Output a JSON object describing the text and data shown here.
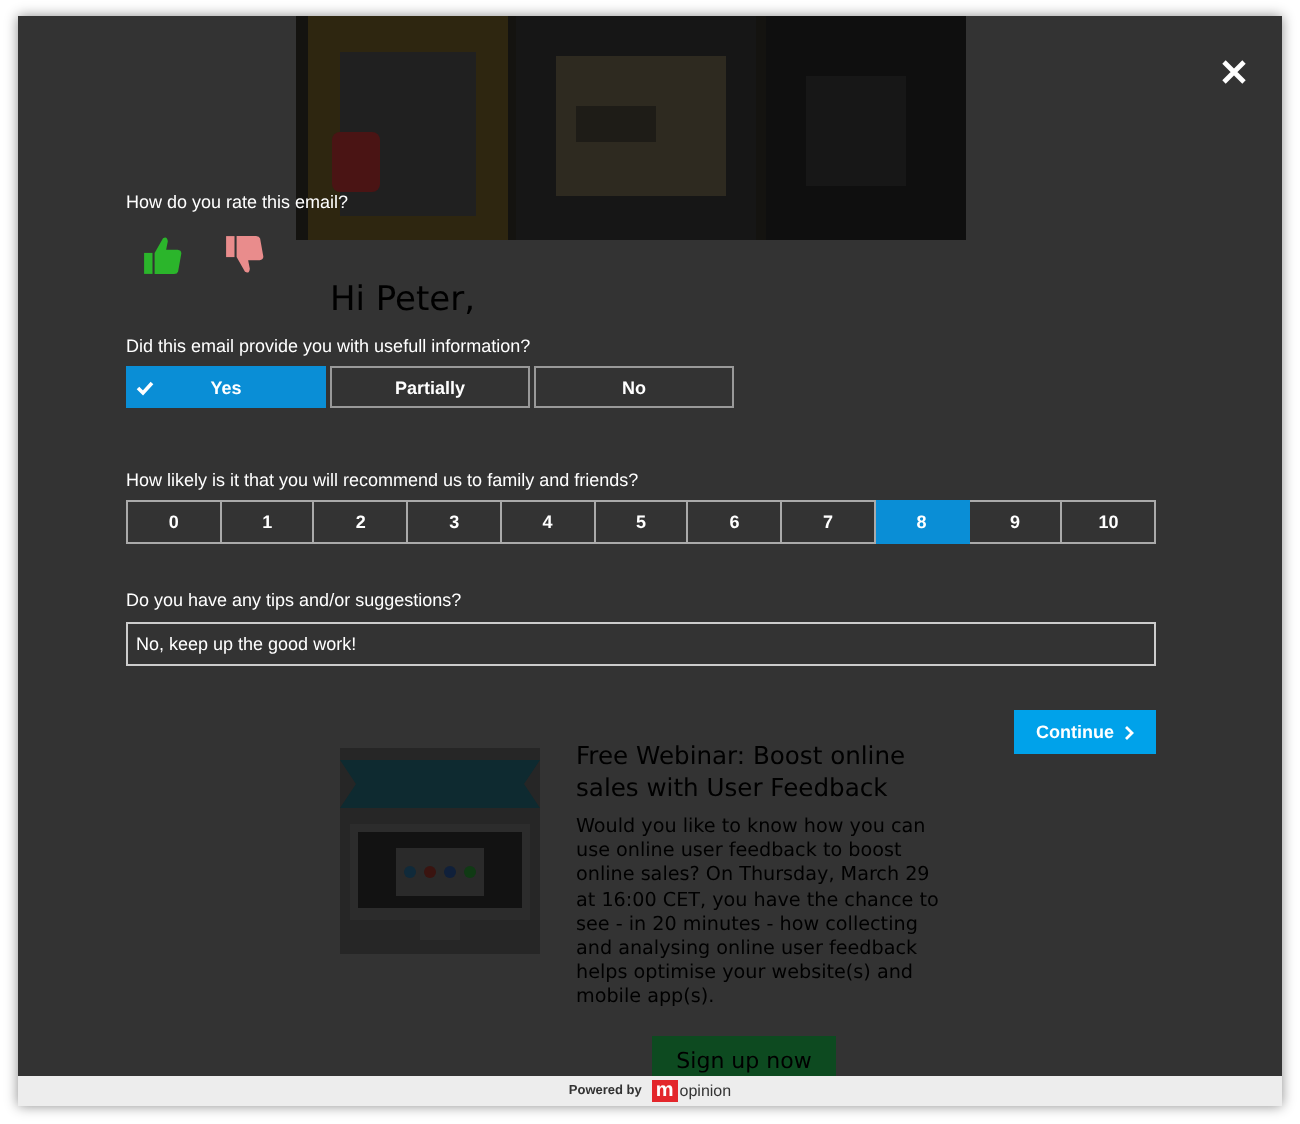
{
  "newsletter": {
    "greeting": "Hi Peter,",
    "webinar": {
      "title": "Free Webinar: Boost online sales with User Feedback",
      "body": "Would you like to know how you can use online user feedback to boost online sales? On Thursday, March 29 at 16:00 CET, you have the chance to see - in 20 minutes - how collecting and analysing online user feedback helps optimise your website(s) and mobile app(s).",
      "button": "Sign up now"
    }
  },
  "survey": {
    "questions": [
      {
        "kind": "thumbs",
        "label": "How do you rate this email?"
      },
      {
        "kind": "choice",
        "label": "Did this email provide you with usefull information?",
        "options": [
          {
            "label": "Yes",
            "selected": true
          },
          {
            "label": "Partially",
            "selected": false
          },
          {
            "label": "No",
            "selected": false
          }
        ]
      },
      {
        "kind": "scale",
        "label": "How likely is it that you will recommend us to family and friends?",
        "options": [
          {
            "label": "0",
            "selected": false
          },
          {
            "label": "1",
            "selected": false
          },
          {
            "label": "2",
            "selected": false
          },
          {
            "label": "3",
            "selected": false
          },
          {
            "label": "4",
            "selected": false
          },
          {
            "label": "5",
            "selected": false
          },
          {
            "label": "6",
            "selected": false
          },
          {
            "label": "7",
            "selected": false
          },
          {
            "label": "8",
            "selected": true
          },
          {
            "label": "9",
            "selected": false
          },
          {
            "label": "10",
            "selected": false
          }
        ]
      },
      {
        "kind": "text",
        "label": "Do you have any tips and/or suggestions?",
        "value": "No, keep up the good work!"
      }
    ],
    "continue": "Continue"
  },
  "footer": {
    "powered_by": "Powered by",
    "logo_mark": "m",
    "logo_word": "opinion"
  }
}
